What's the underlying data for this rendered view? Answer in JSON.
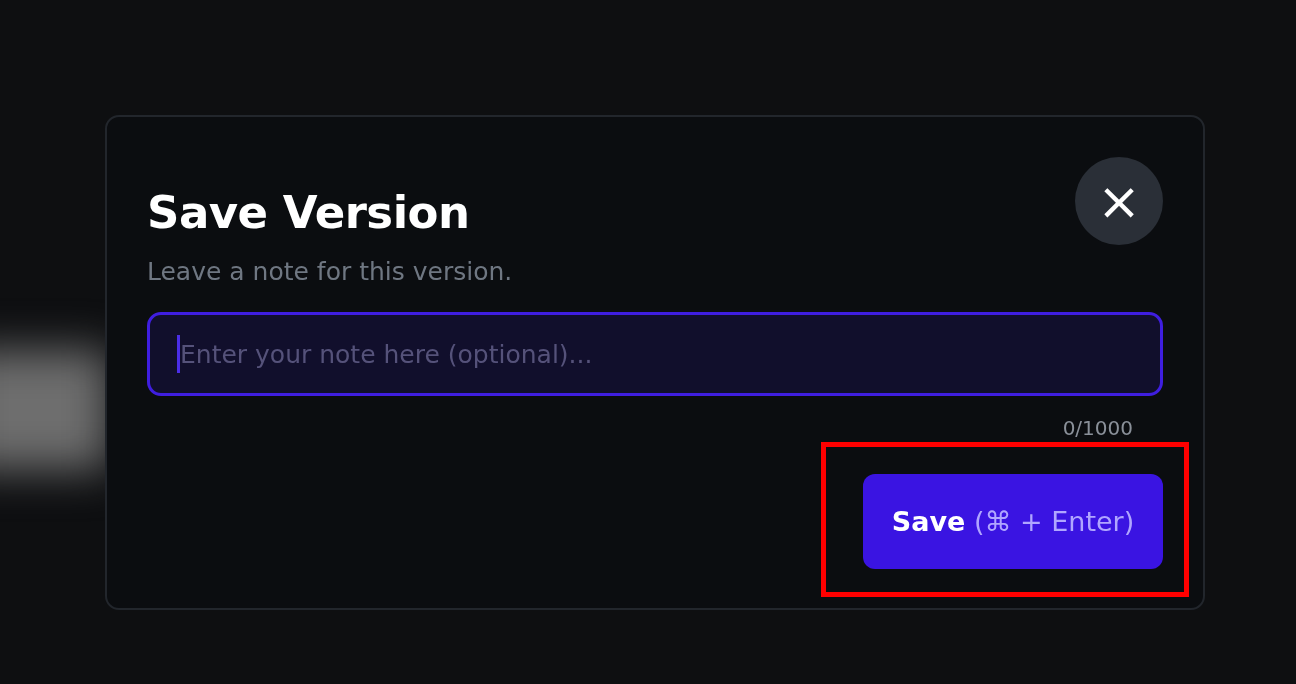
{
  "dialog": {
    "title": "Save Version",
    "subtitle": "Leave a note for this version.",
    "close_label": "×",
    "note_field": {
      "placeholder": "Enter your note here (optional)...",
      "focused": true
    },
    "counter": "0/1000",
    "save_button": {
      "label": "Save",
      "hint": "(⌘ + Enter)",
      "highlighted": true
    }
  }
}
